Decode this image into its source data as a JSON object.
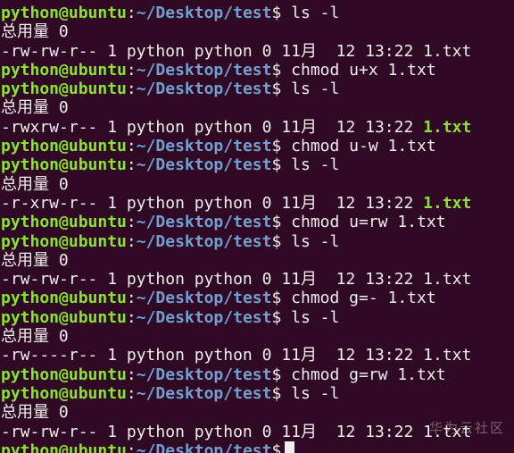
{
  "colors": {
    "background": "#300a24",
    "prompt_user": "#8ae234",
    "prompt_path": "#729fcf",
    "text": "#eeeeec",
    "executable": "#8ae234"
  },
  "prompt": {
    "user_host": "python@ubuntu",
    "separator": ":",
    "path": "~/Desktop/test",
    "symbol": "$"
  },
  "lines": [
    {
      "kind": "prompt",
      "command": "ls -l"
    },
    {
      "kind": "output",
      "text": "总用量 0"
    },
    {
      "kind": "listing",
      "text": "-rw-rw-r-- 1 python python 0 11月  12 13:22 ",
      "filename": "1.txt",
      "executable": false
    },
    {
      "kind": "prompt",
      "command": "chmod u+x 1.txt"
    },
    {
      "kind": "prompt",
      "command": "ls -l"
    },
    {
      "kind": "output",
      "text": "总用量 0"
    },
    {
      "kind": "listing",
      "text": "-rwxrw-r-- 1 python python 0 11月  12 13:22 ",
      "filename": "1.txt",
      "executable": true
    },
    {
      "kind": "prompt",
      "command": "chmod u-w 1.txt"
    },
    {
      "kind": "prompt",
      "command": "ls -l"
    },
    {
      "kind": "output",
      "text": "总用量 0"
    },
    {
      "kind": "listing",
      "text": "-r-xrw-r-- 1 python python 0 11月  12 13:22 ",
      "filename": "1.txt",
      "executable": true
    },
    {
      "kind": "prompt",
      "command": "chmod u=rw 1.txt"
    },
    {
      "kind": "prompt",
      "command": "ls -l"
    },
    {
      "kind": "output",
      "text": "总用量 0"
    },
    {
      "kind": "listing",
      "text": "-rw-rw-r-- 1 python python 0 11月  12 13:22 ",
      "filename": "1.txt",
      "executable": false
    },
    {
      "kind": "prompt",
      "command": "chmod g=- 1.txt"
    },
    {
      "kind": "prompt",
      "command": "ls -l"
    },
    {
      "kind": "output",
      "text": "总用量 0"
    },
    {
      "kind": "listing",
      "text": "-rw----r-- 1 python python 0 11月  12 13:22 ",
      "filename": "1.txt",
      "executable": false
    },
    {
      "kind": "prompt",
      "command": "chmod g=rw 1.txt"
    },
    {
      "kind": "prompt",
      "command": "ls -l"
    },
    {
      "kind": "output",
      "text": "总用量 0"
    },
    {
      "kind": "listing",
      "text": "-rw-rw-r-- 1 python python 0 11月  12 13:22 ",
      "filename": "1.txt",
      "executable": false
    },
    {
      "kind": "prompt",
      "command": "",
      "active": true
    }
  ],
  "watermark": "华为云社区"
}
